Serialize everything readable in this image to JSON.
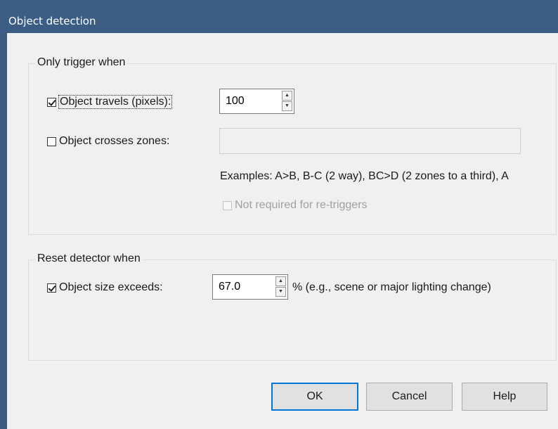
{
  "window": {
    "title": "Object detection"
  },
  "trigger_group": {
    "legend": "Only trigger when",
    "travels": {
      "checked": true,
      "label": "Object travels (pixels):",
      "value": "100"
    },
    "crosses": {
      "checked": false,
      "label": "Object crosses zones:",
      "value": ""
    },
    "examples_text": "Examples:  A>B, B-C (2 way), BC>D (2 zones to a third), A",
    "not_required": {
      "checked": false,
      "enabled": false,
      "label": "Not required for re-triggers"
    }
  },
  "reset_group": {
    "legend": "Reset detector when",
    "size": {
      "checked": true,
      "label": "Object size exceeds:",
      "value": "67.0",
      "suffix": "% (e.g., scene or major lighting change)"
    }
  },
  "buttons": {
    "ok": "OK",
    "cancel": "Cancel",
    "help": "Help"
  },
  "icons": {
    "spin_up": "▲",
    "spin_down": "▼"
  },
  "colors": {
    "titlebar": "#3b5c83",
    "dialog_bg": "#f0f0f0",
    "default_button_border": "#0078d7"
  }
}
